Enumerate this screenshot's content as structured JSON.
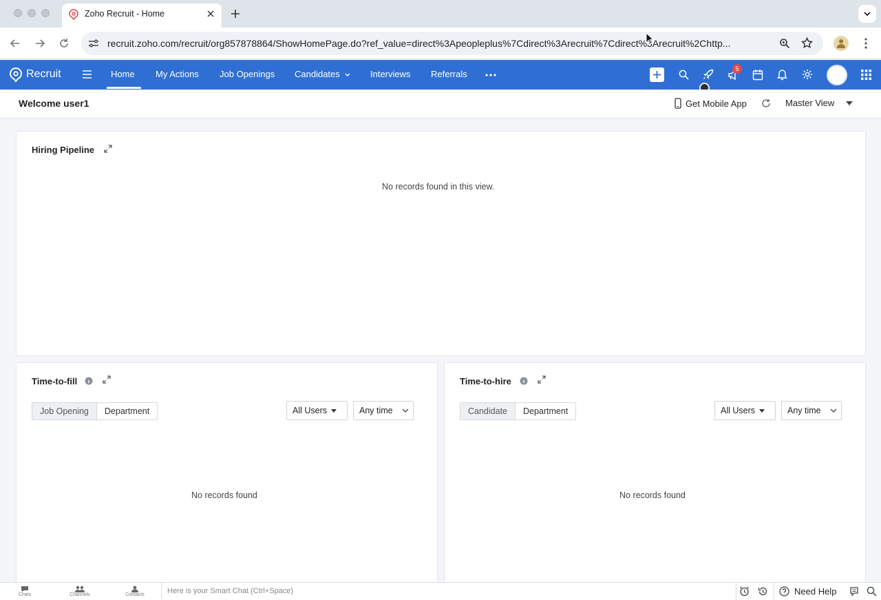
{
  "browser": {
    "tab_title": "Zoho Recruit - Home",
    "url": "recruit.zoho.com/recruit/org857878864/ShowHomePage.do?ref_value=direct%3Apeopleplus%7Cdirect%3Arecruit%7Cdirect%3Arecruit%2Chttp..."
  },
  "app": {
    "brand": "Recruit",
    "nav": [
      "Home",
      "My Actions",
      "Job Openings",
      "Candidates",
      "Interviews",
      "Referrals"
    ],
    "active_nav": "Home",
    "notification_count": "5"
  },
  "subheader": {
    "welcome": "Welcome user1",
    "mobile_app": "Get Mobile App",
    "view": "Master View"
  },
  "hiring_pipeline": {
    "title": "Hiring Pipeline",
    "empty": "No records found in this view."
  },
  "time_to_fill": {
    "title": "Time-to-fill",
    "tabs": [
      "Job Opening",
      "Department"
    ],
    "users": "All Users",
    "period": "Any time",
    "empty": "No records found"
  },
  "time_to_hire": {
    "title": "Time-to-hire",
    "tabs": [
      "Candidate",
      "Department"
    ],
    "users": "All Users",
    "period": "Any time",
    "empty": "No records found"
  },
  "footer": {
    "items": [
      "Chats",
      "Channels",
      "Contacts"
    ],
    "smart_chat_placeholder": "Here is your Smart Chat (Ctrl+Space)",
    "help": "Need Help"
  },
  "colors": {
    "brand_blue": "#2f6fd4",
    "badge_red": "#e5484d"
  }
}
